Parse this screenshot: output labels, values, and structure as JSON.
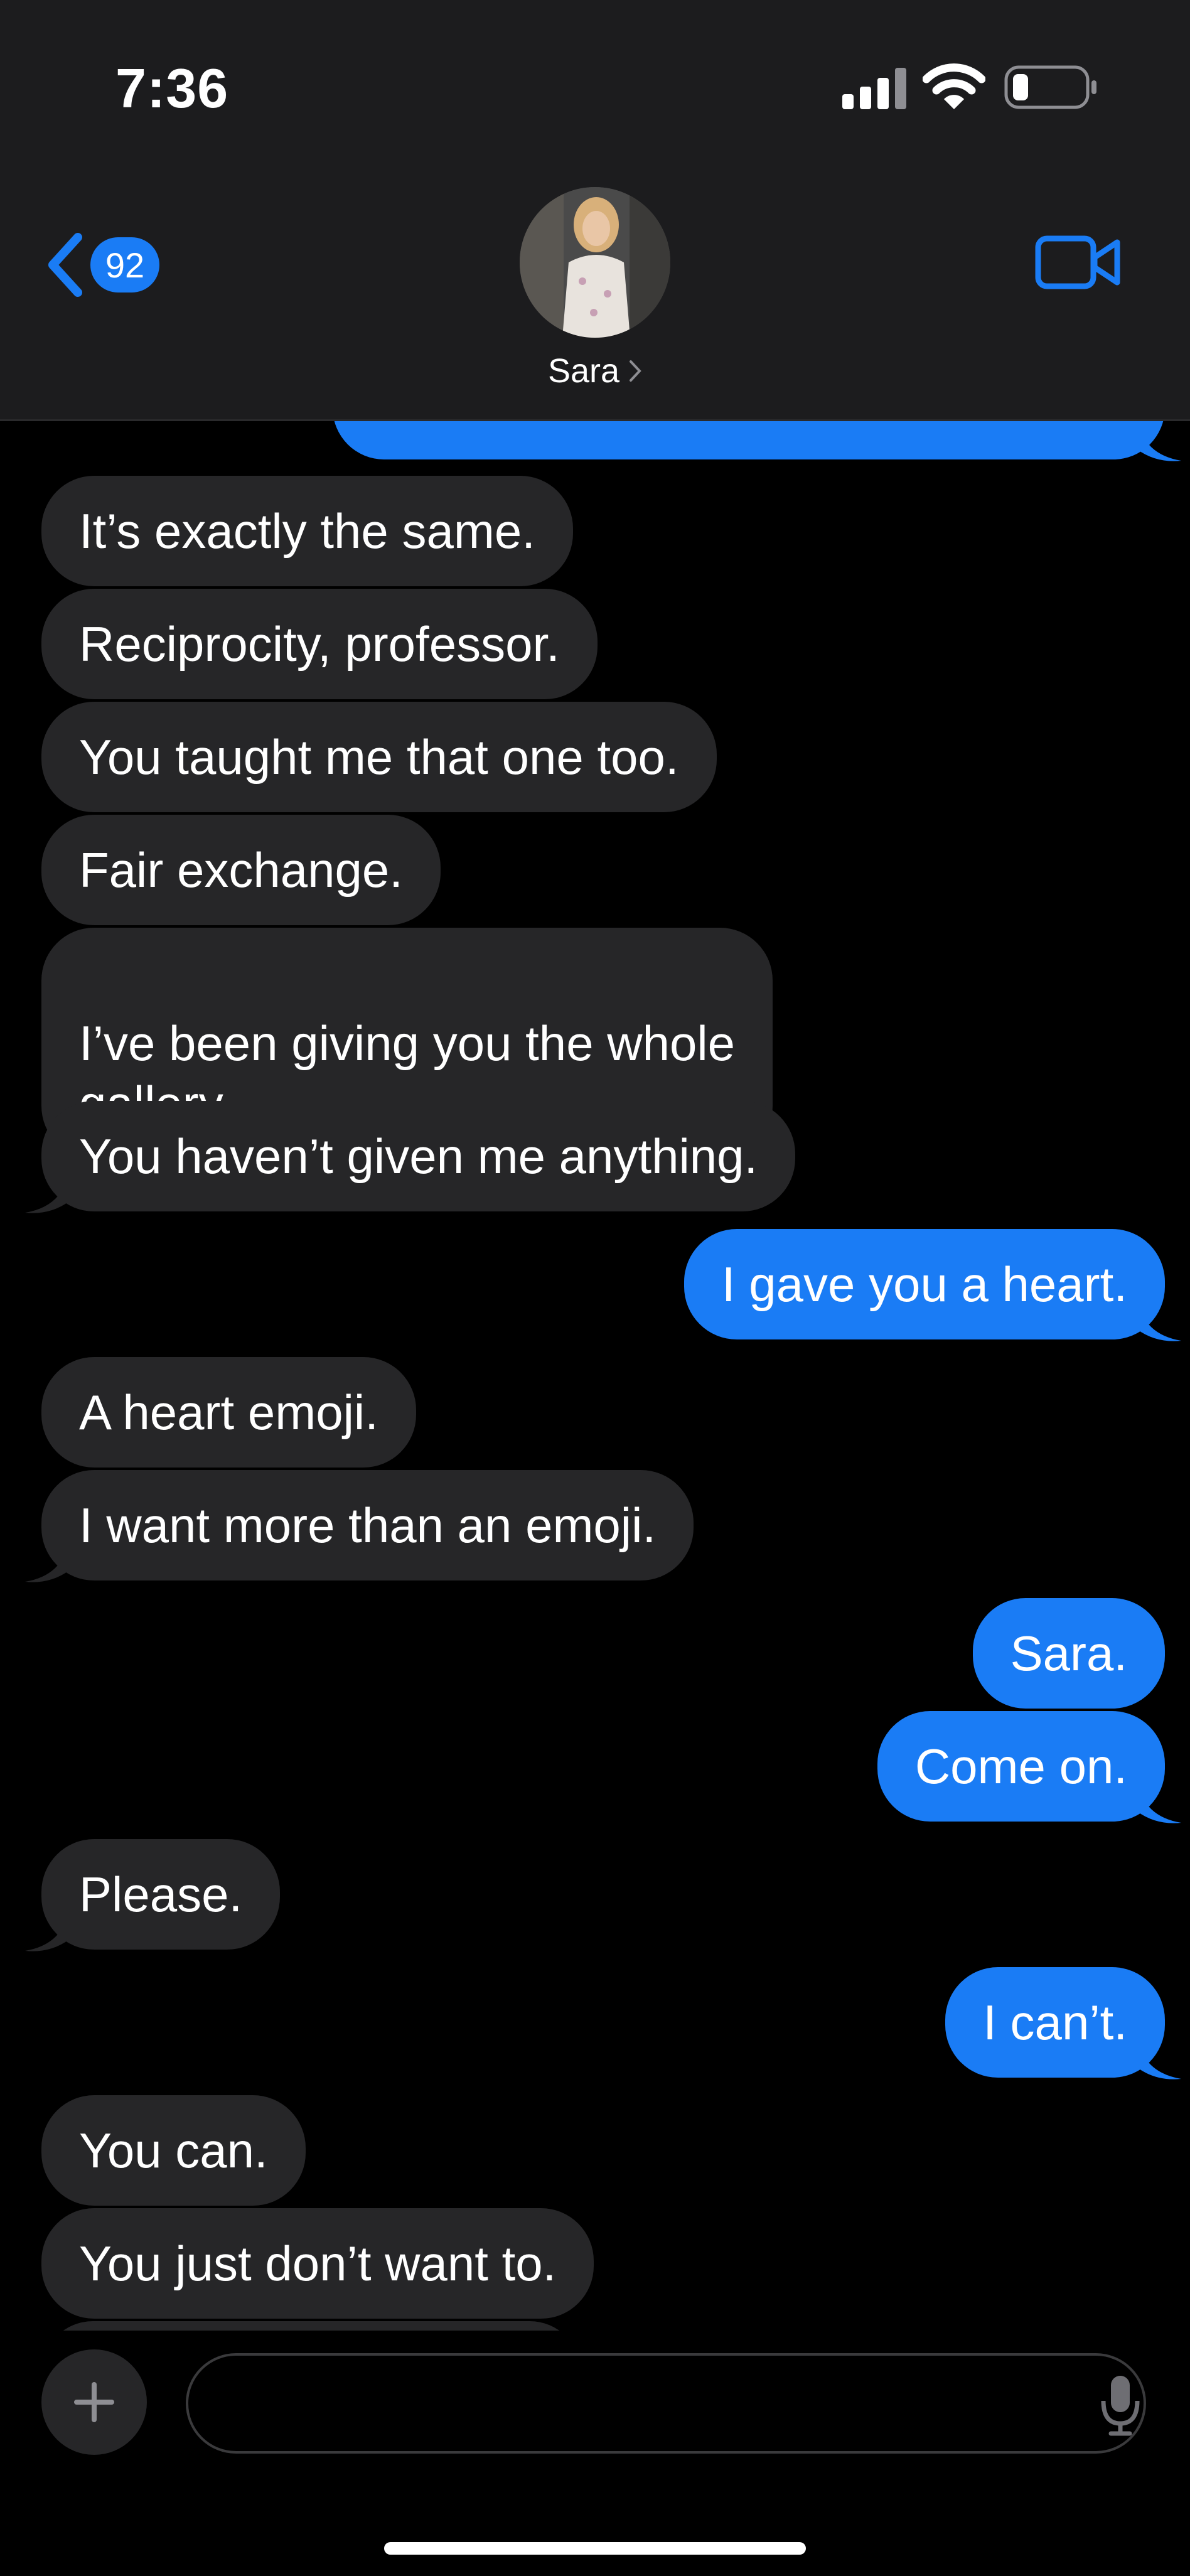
{
  "status_bar": {
    "time": "7:36"
  },
  "header": {
    "back_badge": "92",
    "contact_name": "Sara"
  },
  "messages": [
    {
      "side": "in",
      "text": "It’s exactly the same."
    },
    {
      "side": "in",
      "text": "Reciprocity, professor."
    },
    {
      "side": "in",
      "text": "You taught me that one too."
    },
    {
      "side": "in",
      "text": "Fair exchange."
    },
    {
      "side": "in",
      "text": "I’ve been giving you the whole\ngallery."
    },
    {
      "side": "in",
      "text": "You haven’t given me anything."
    },
    {
      "side": "out",
      "text": "I gave you a heart."
    },
    {
      "side": "in",
      "text": "A heart emoji."
    },
    {
      "side": "in",
      "text": "I want more than an emoji."
    },
    {
      "side": "out",
      "text": "Sara."
    },
    {
      "side": "out",
      "text": "Come on."
    },
    {
      "side": "in",
      "text": "Please."
    },
    {
      "side": "out",
      "text": "I can’t."
    },
    {
      "side": "in",
      "text": "You can."
    },
    {
      "side": "in",
      "text": "You just don’t want to."
    }
  ],
  "composer": {
    "placeholder": ""
  },
  "colors": {
    "accent": "#1a7cf5",
    "incoming_bubble": "#262628",
    "header_bg": "#1c1c1e"
  },
  "icons": [
    "signal-icon",
    "wifi-icon",
    "battery-icon",
    "back-chevron-icon",
    "video-call-icon",
    "plus-icon",
    "microphone-icon"
  ]
}
